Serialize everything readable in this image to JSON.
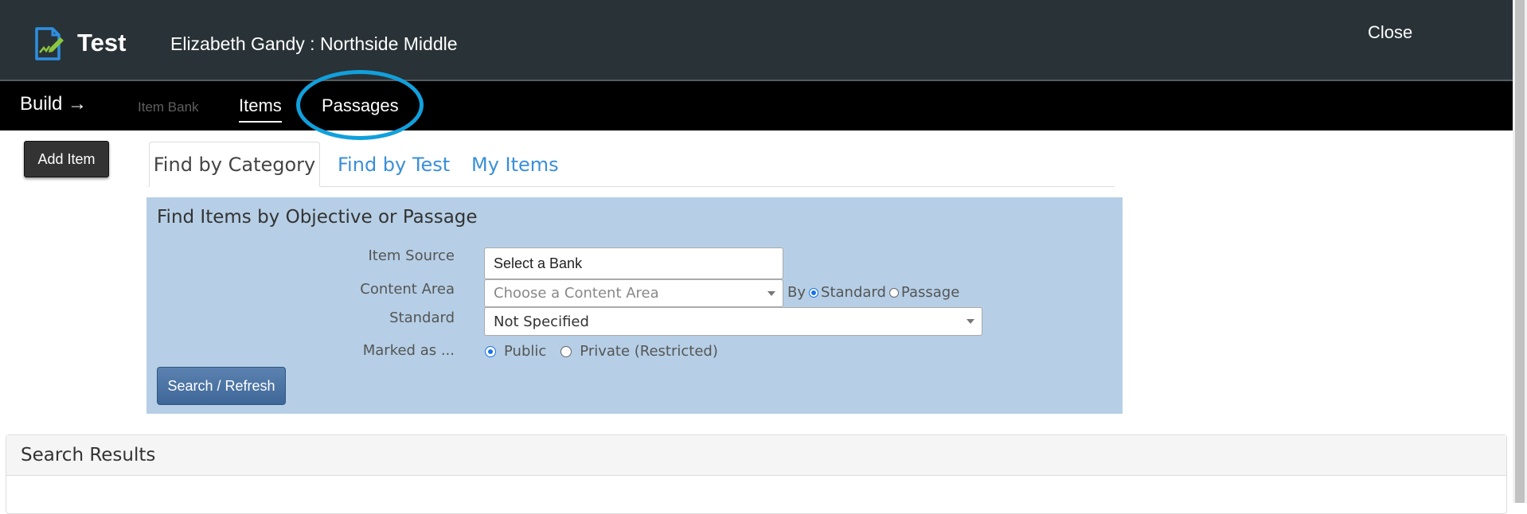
{
  "header": {
    "app_title": "Test",
    "user_title": "Elizabeth Gandy : Northside Middle",
    "close_label": "Close",
    "logo_icon": "test-document-icon",
    "logo_colors": {
      "paper": "#2f8fe0",
      "pencil": "#8cc63f"
    }
  },
  "nav": {
    "build_label": "Build →",
    "item_bank_label": "Item Bank",
    "items_label": "Items",
    "passages_label": "Passages",
    "highlight_color": "#11a0dc"
  },
  "add_item_label": "Add Item",
  "tabs": [
    {
      "label": "Find by Category",
      "active": true
    },
    {
      "label": "Find by Test",
      "active": false
    },
    {
      "label": "My Items",
      "active": false
    }
  ],
  "panel": {
    "title": "Find Items by Objective or Passage",
    "background": "#b6cfe6",
    "item_source_label": "Item Source",
    "item_source_value": "Select a Bank",
    "content_area_label": "Content Area",
    "content_area_placeholder": "Choose a Content Area",
    "by_label": "By",
    "by_options": [
      {
        "label": "Standard",
        "selected": true
      },
      {
        "label": "Passage",
        "selected": false
      }
    ],
    "standard_label": "Standard",
    "standard_value": "Not Specified",
    "marked_label": "Marked as ...",
    "marked_options": [
      {
        "label": "Public",
        "selected": true
      },
      {
        "label": "Private (Restricted)",
        "selected": false
      }
    ],
    "search_button_label": "Search / Refresh"
  },
  "results": {
    "title": "Search Results"
  }
}
